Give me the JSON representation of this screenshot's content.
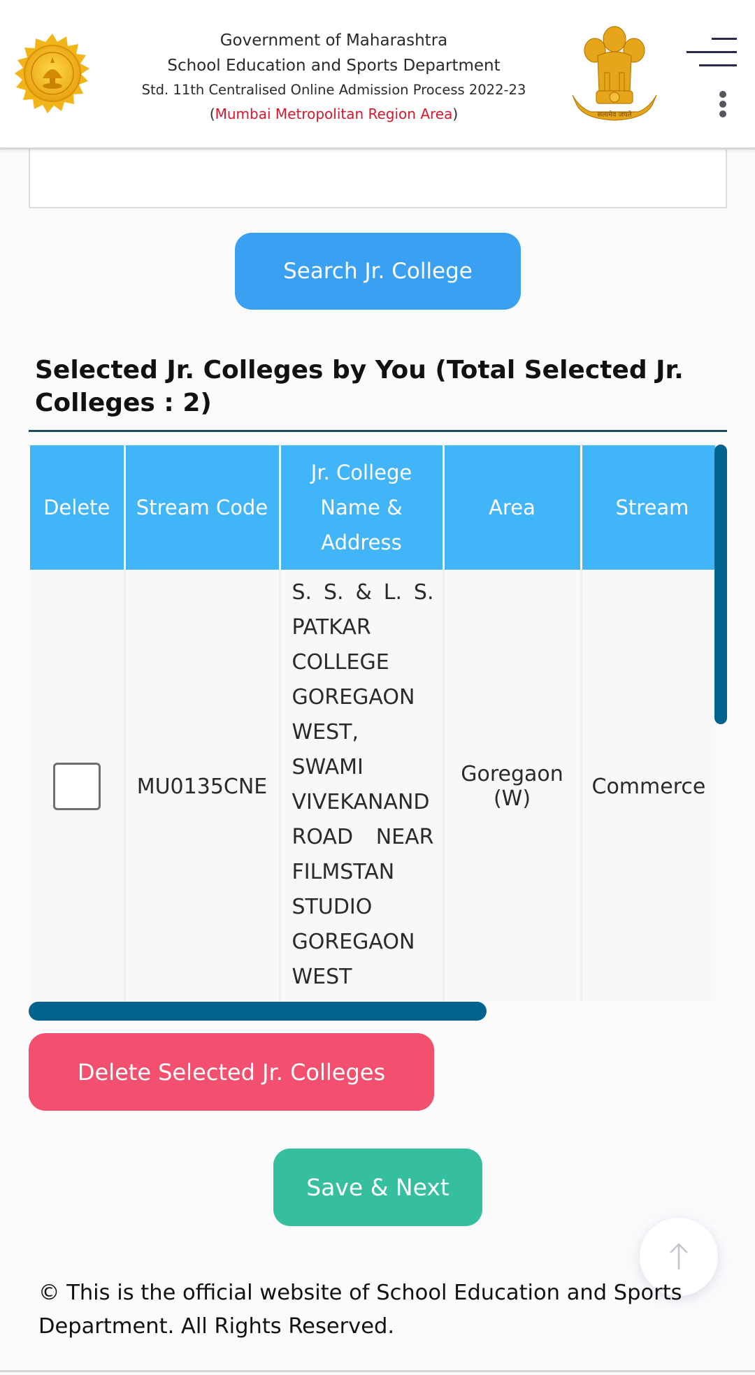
{
  "header": {
    "line1": "Government of Maharashtra",
    "line2": "School Education and Sports Department",
    "line3": "Std. 11th Centralised Online Admission Process 2022-23",
    "line4_open": "(",
    "line4_region": "Mumbai Metropolitan Region Area",
    "line4_close": ")",
    "left_logo": "maharashtra-seal-icon",
    "right_logo": "ashoka-emblem-icon",
    "menu_icon": "hamburger-icon",
    "more_icon": "kebab-icon",
    "emblem_motto": "सत्यमेव जयते"
  },
  "actions": {
    "search_label": "Search Jr. College",
    "delete_label": "Delete Selected Jr. Colleges",
    "save_label": "Save & Next"
  },
  "selected": {
    "title": "Selected Jr. Colleges by You (Total Selected Jr. Colleges : 2)",
    "total": 2,
    "columns": [
      "Delete",
      "Stream Code",
      "Jr. College Name & Address",
      "Area",
      "Stream"
    ],
    "rows": [
      {
        "checked": false,
        "stream_code": "MU0135CNE",
        "name_address": "S. S. & L. S. PATKAR COLLEGE GOREGAON WEST, SWAMI VIVEKANAND ROAD NEAR FILMSTAN STUDIO GOREGAON WEST",
        "area": "Goregaon (W)",
        "stream": "Commerce"
      }
    ]
  },
  "footer": {
    "text": "© This is the official website of School Education and Sports Department. All Rights Reserved."
  },
  "colors": {
    "search_button": "#3aa0f2",
    "table_header": "#42b4f8",
    "delete_button": "#f2506e",
    "save_button": "#35bf9f",
    "scrollbar": "#04628f",
    "region_text": "#d8172e"
  }
}
